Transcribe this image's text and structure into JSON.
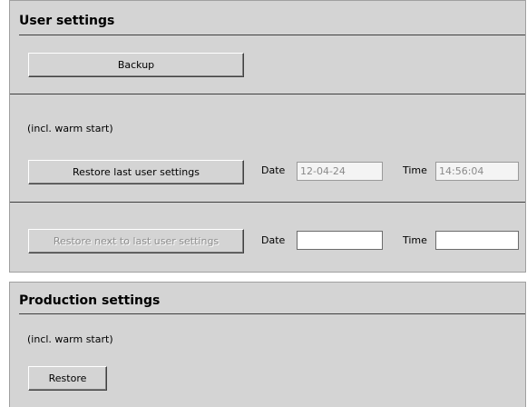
{
  "user_settings": {
    "title": "User settings",
    "backup_label": "Backup",
    "warm_start_note": "(incl. warm start)",
    "restore_last": {
      "label": "Restore last user settings",
      "date_label": "Date",
      "date_value": "12-04-24",
      "time_label": "Time",
      "time_value": "14:56:04"
    },
    "restore_next_to_last": {
      "label": "Restore next to last user settings",
      "enabled": false,
      "date_label": "Date",
      "date_value": "",
      "time_label": "Time",
      "time_value": ""
    }
  },
  "production_settings": {
    "title": "Production settings",
    "warm_start_note": "(incl. warm start)",
    "restore_label": "Restore"
  }
}
